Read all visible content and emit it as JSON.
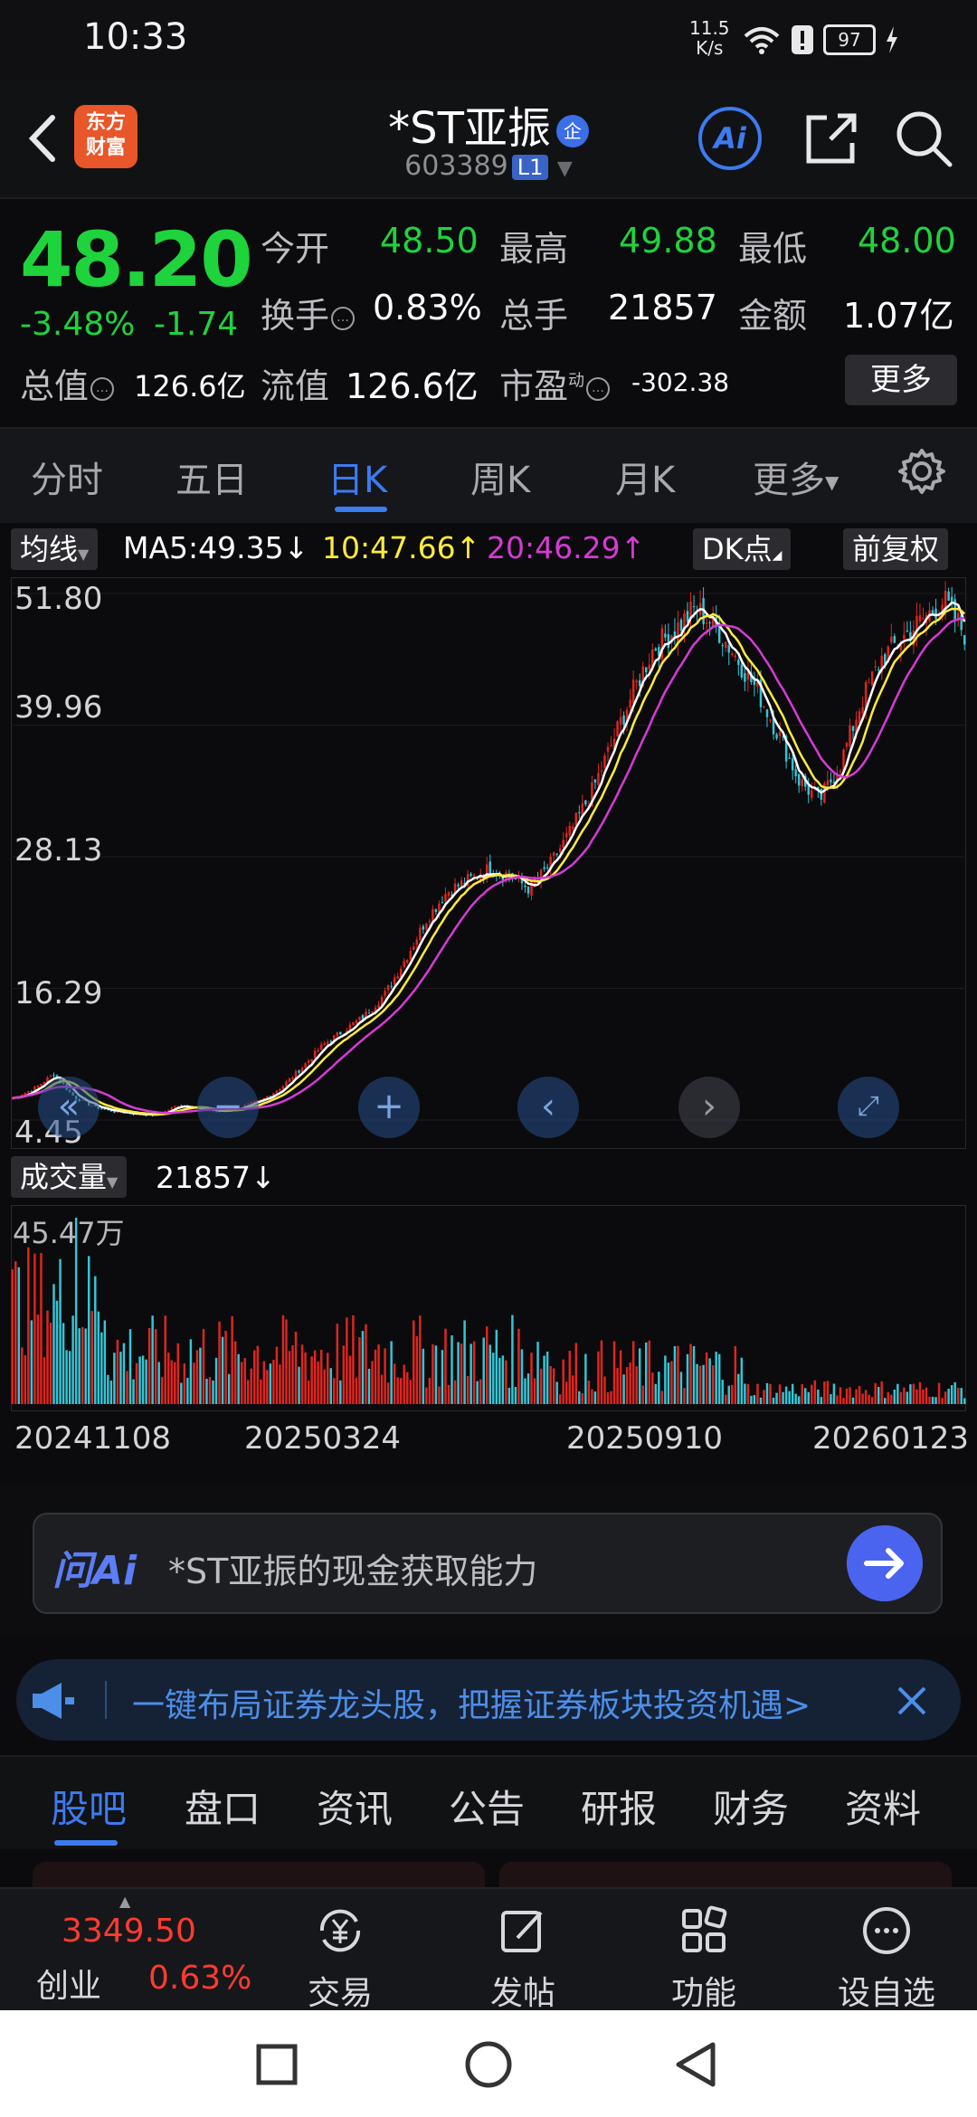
{
  "status_bar": {
    "time": "10:33",
    "net_speed_value": "11.5",
    "net_speed_unit": "K/s",
    "battery": "97"
  },
  "header": {
    "logo_line1": "东方",
    "logo_line2": "财富",
    "stock_name": "*ST亚振",
    "badge": "企",
    "stock_code": "603389",
    "level": "L1",
    "ai_label": "Ai"
  },
  "quote": {
    "price": "48.20",
    "change_pct": "-3.48%",
    "change_amt": "-1.74",
    "open_label": "今开",
    "open": "48.50",
    "high_label": "最高",
    "high": "49.88",
    "low_label": "最低",
    "low": "48.00",
    "turnover_label": "换手",
    "turnover": "0.83%",
    "volume_label": "总手",
    "volume": "21857",
    "amount_label": "金额",
    "amount": "1.07亿",
    "mktcap_label": "总值",
    "mktcap": "126.6亿",
    "float_label": "流值",
    "float": "126.6亿",
    "pe_label": "市盈",
    "pe_sup": "动",
    "pe": "-302.38",
    "more": "更多"
  },
  "period_tabs": [
    "分时",
    "五日",
    "日K",
    "周K",
    "月K",
    "更多"
  ],
  "active_period": 2,
  "ma": {
    "chip": "均线",
    "ma5": "MA5:49.35↓",
    "ma10": "10:47.66↑",
    "ma20": "20:46.29↑",
    "dk": "DK点",
    "adjust": "前复权",
    "colors": {
      "ma5": "#ffffff",
      "ma10": "#ffeb3b",
      "ma20": "#d63ad6"
    }
  },
  "volume_header": {
    "chip": "成交量",
    "value": "21857↓",
    "max_label": "45.47万"
  },
  "chart_data": {
    "type": "candlestick",
    "y_tick_labels": [
      "51.80",
      "39.96",
      "28.13",
      "16.29",
      "4.45"
    ],
    "ylim": [
      4.45,
      51.8
    ],
    "x_tick_labels": [
      "20241108",
      "20250324",
      "20250910",
      "20260123"
    ],
    "close_path": [
      6.4,
      7.2,
      8.6,
      6.5,
      5.6,
      5.2,
      5.0,
      4.9,
      5.8,
      5.5,
      5.2,
      5.6,
      6.2,
      7.4,
      9.2,
      11.2,
      12.5,
      13.8,
      15.8,
      19.0,
      22.5,
      25.0,
      26.0,
      27.0,
      26.5,
      25.2,
      27.5,
      30.5,
      34.0,
      38.5,
      43.0,
      47.0,
      48.5,
      50.5,
      48.8,
      46.0,
      43.0,
      39.2,
      35.0,
      33.2,
      36.5,
      42.0,
      46.0,
      47.8,
      49.5,
      51.2,
      48.2
    ],
    "series": [
      {
        "name": "MA5",
        "color": "#ffffff"
      },
      {
        "name": "MA10",
        "color": "#ffeb3b"
      },
      {
        "name": "MA20",
        "color": "#d63ad6"
      }
    ],
    "volume_max": "45.47万",
    "up_color": "#e0251f",
    "down_color": "#35c6d6"
  },
  "ask_ai": {
    "logo": "问Ai",
    "prompt": "*ST亚振的现金获取能力"
  },
  "banner": {
    "text": "一键布局证券龙头股，把握证券板块投资机遇>"
  },
  "content_tabs": [
    "股吧",
    "盘口",
    "资讯",
    "公告",
    "研报",
    "财务",
    "资料"
  ],
  "bottom_bar": {
    "index_value": "3349.50",
    "index_name": "创业",
    "index_pct": "0.63%",
    "items": [
      "交易",
      "发帖",
      "功能",
      "设自选"
    ]
  }
}
